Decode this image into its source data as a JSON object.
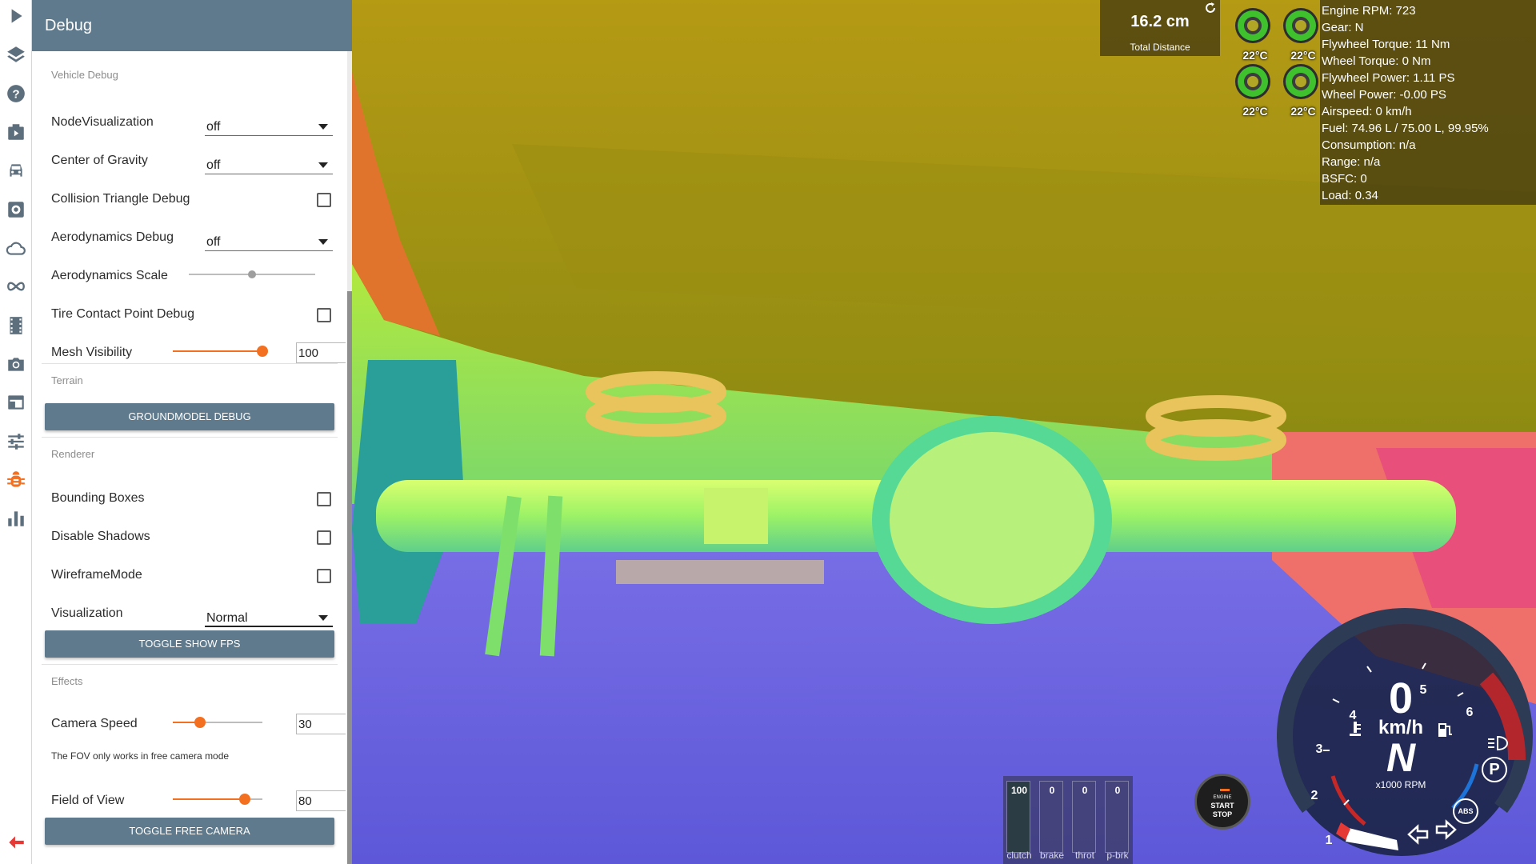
{
  "panel": {
    "title": "Debug",
    "vehicle_debug": {
      "heading": "Vehicle Debug",
      "node_visualization": {
        "label": "NodeVisualization",
        "value": "off"
      },
      "center_of_gravity": {
        "label": "Center of Gravity",
        "value": "off"
      },
      "collision_triangle_debug": {
        "label": "Collision Triangle Debug",
        "checked": false
      },
      "aerodynamics_debug": {
        "label": "Aerodynamics Debug",
        "value": "off"
      },
      "aerodynamics_scale": {
        "label": "Aerodynamics Scale",
        "level": 0.5
      },
      "tire_contact_point_debug": {
        "label": "Tire Contact Point Debug",
        "checked": false
      },
      "mesh_visibility": {
        "label": "Mesh Visibility",
        "value": "100",
        "level": 1.0
      }
    },
    "terrain": {
      "heading": "Terrain",
      "groundmodel_button": "GROUNDMODEL DEBUG"
    },
    "renderer": {
      "heading": "Renderer",
      "bounding_boxes": {
        "label": "Bounding Boxes",
        "checked": false
      },
      "disable_shadows": {
        "label": "Disable Shadows",
        "checked": false
      },
      "wireframe_mode": {
        "label": "WireframeMode",
        "checked": false
      },
      "visualization": {
        "label": "Visualization",
        "value": "Normal"
      },
      "toggle_fps_button": "TOGGLE SHOW FPS"
    },
    "effects": {
      "heading": "Effects",
      "camera_speed": {
        "label": "Camera Speed",
        "value": "30",
        "level": 0.3
      },
      "fov_note": "The FOV only works in free camera mode",
      "field_of_view": {
        "label": "Field of View",
        "value": "80",
        "level": 0.8
      },
      "toggle_free_camera_button": "TOGGLE FREE CAMERA"
    }
  },
  "iconbar": {
    "icons": [
      "play-icon",
      "layers-icon",
      "help-icon",
      "playlist-icon",
      "car-icon",
      "settings-icon",
      "cloud-icon",
      "infinity-icon",
      "film-icon",
      "camera-icon",
      "window-icon",
      "tune-icon",
      "bug-icon",
      "stats-icon",
      "back-arrow-icon"
    ],
    "active": "bug-icon",
    "accent_color": "#f37021"
  },
  "hud": {
    "distance": {
      "value": "16.2 cm",
      "caption": "Total Distance"
    },
    "tire_temps": [
      "22°C",
      "22°C",
      "22°C",
      "22°C"
    ],
    "engine_info": [
      "Engine RPM: 723",
      "Gear: N",
      "Flywheel Torque: 11 Nm",
      "Wheel Torque: 0 Nm",
      "Flywheel Power: 1.11 PS",
      "Wheel Power: -0.00 PS",
      "Airspeed: 0 km/h",
      "Fuel: 74.96 L / 75.00 L, 99.95%",
      "Consumption: n/a",
      "Range: n/a",
      "BSFC: 0",
      "Load: 0.34"
    ],
    "pedals": [
      {
        "label": "clutch",
        "value": "100",
        "level": 1.0
      },
      {
        "label": "brake",
        "value": "0",
        "level": 0
      },
      {
        "label": "throt",
        "value": "0",
        "level": 0
      },
      {
        "label": "p-brk",
        "value": "0",
        "level": 0
      }
    ],
    "engine_button": {
      "line1": "ENGINE",
      "line2": "START",
      "line3": "STOP"
    },
    "gauge": {
      "speed": "0",
      "speed_unit": "km/h",
      "gear": "N",
      "rpm_unit": "x1000 RPM",
      "rpm_ticks": [
        "1",
        "2",
        "3",
        "4",
        "5",
        "6"
      ],
      "parking_indicator": "P",
      "abs_indicator": "ABS"
    }
  }
}
